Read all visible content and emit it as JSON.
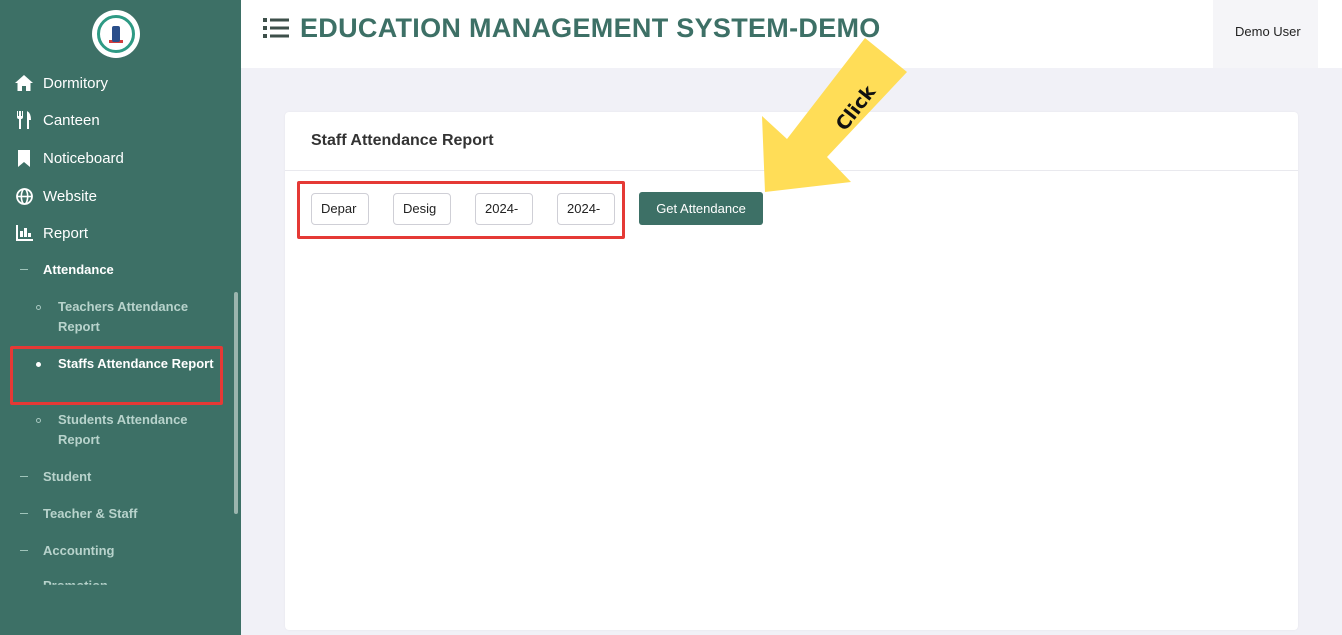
{
  "app": {
    "title": "EDUCATION MANAGEMENT SYSTEM-DEMO",
    "user": "Demo User"
  },
  "sidebar": {
    "items": [
      {
        "label": "Dormitory",
        "icon": "home-icon"
      },
      {
        "label": "Canteen",
        "icon": "utensils-icon"
      },
      {
        "label": "Noticeboard",
        "icon": "bookmark-icon"
      },
      {
        "label": "Website",
        "icon": "globe-icon"
      },
      {
        "label": "Report",
        "icon": "chart-icon"
      }
    ],
    "report_sub": {
      "attendance": "Attendance",
      "leaves": [
        "Teachers Attendance Report",
        "Staffs Attendance Report",
        "Students Attendance Report"
      ],
      "others": [
        "Student",
        "Teacher & Staff",
        "Accounting",
        "Promotion"
      ]
    }
  },
  "card": {
    "title": "Staff Attendance Report",
    "fields": [
      {
        "name": "department",
        "value": "Depar"
      },
      {
        "name": "designation",
        "value": "Desig"
      },
      {
        "name": "from-date",
        "value": "2024-"
      },
      {
        "name": "to-date",
        "value": "2024-"
      }
    ],
    "button": "Get Attendance"
  },
  "annotation": {
    "arrow_text": "Click",
    "highlight_color": "#e53935",
    "arrow_color": "#ffdd57"
  },
  "colors": {
    "primary": "#3d7066",
    "background": "#f1f1f7"
  }
}
